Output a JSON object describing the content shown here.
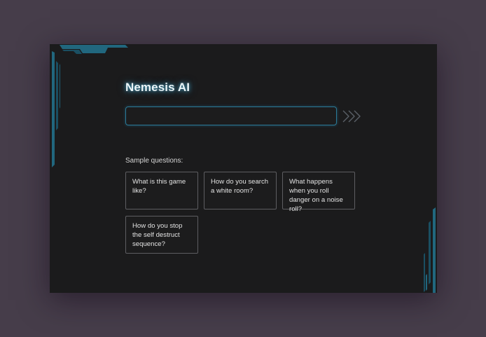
{
  "app": {
    "title": "Nemesis AI"
  },
  "search": {
    "value": "",
    "placeholder": ""
  },
  "samples": {
    "label": "Sample questions:",
    "questions": [
      "What is this game like?",
      "How do you search a white room?",
      "What happens when you roll danger on a noise roll?",
      "How do you stop the self destruct sequence?"
    ]
  },
  "icons": {
    "submit": "triple-chevron-right-icon",
    "corner_top_left": "circuit-frame-top-left",
    "corner_bottom_right": "circuit-frame-bottom-right"
  },
  "colors": {
    "page_background": "#463d4a",
    "window_background": "#1b1b1c",
    "accent": "#2b7a98",
    "title_glow": "#50bee6",
    "card_border": "#5e5e62",
    "icon_stroke": "#5a6068"
  }
}
